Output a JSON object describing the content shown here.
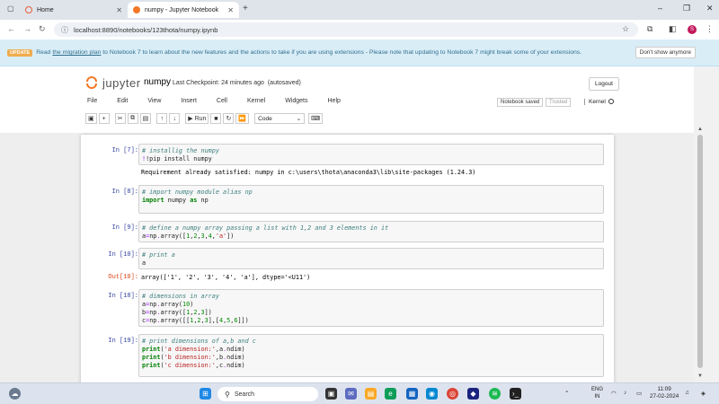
{
  "browser": {
    "tabs": [
      {
        "label": "Home",
        "active": false
      },
      {
        "label": "numpy - Jupyter Notebook",
        "active": true
      }
    ],
    "new_tab": "+",
    "url": "localhost:8890/notebooks/123thota/numpy.ipynb",
    "profile_initial": "S",
    "window_controls": [
      "–",
      "❐",
      "✕"
    ]
  },
  "banner": {
    "badge": "UPDATE",
    "text_pre": "Read",
    "link": "the migration plan",
    "text_post": "to Notebook 7 to learn about the new features and the actions to take if you are using extensions - Please note that updating to Notebook 7 might break some of your extensions.",
    "dismiss": "Don't show anymore"
  },
  "jupyter": {
    "logo_text": "jupyter",
    "notebook_name": "numpy",
    "checkpoint": "Last Checkpoint: 24 minutes ago",
    "autosaved": "(autosaved)",
    "logout": "Logout",
    "menus": [
      "File",
      "Edit",
      "View",
      "Insert",
      "Cell",
      "Kernel",
      "Widgets",
      "Help"
    ],
    "status": "Notebook saved",
    "trusted": "Trusted",
    "kernel_label": "Kernel",
    "run_label": "Run",
    "cell_type": "Code"
  },
  "cells": [
    {
      "prompt": "In [7]:",
      "comment": "# installig the numpy",
      "code": [
        "!pip install numpy"
      ],
      "output": "Requirement already satisfied: numpy in c:\\users\\thota\\anaconda3\\lib\\site-packages (1.24.3)"
    },
    {
      "prompt": "In [8]:",
      "comment": "# import numpy module alias np",
      "code": [
        "import numpy as np"
      ]
    },
    {
      "prompt": "In [9]:",
      "comment": "# define a numpy array passing a list with 1,2 and 3 elements in it",
      "code": [
        "a=np.array([1,2,3,4,'a'])"
      ]
    },
    {
      "prompt": "In [10]:",
      "comment": "# print a",
      "code": [
        "a"
      ],
      "out_prompt": "Out[10]:",
      "output": "array(['1', '2', '3', '4', 'a'], dtype='<U11')"
    },
    {
      "prompt": "In [18]:",
      "comment": "# dimensions in array",
      "code": [
        "a=np.array(10)",
        "b=np.array([1,2,3])",
        "c=np.array([[1,2,3],[4,5,6]])"
      ]
    },
    {
      "prompt": "In [19]:",
      "comment": "# print dimensions of a,b and c",
      "code": [
        "print('a dimension:',a.ndim)",
        "print('b dimension:',b.ndim)",
        "print('c dimension:',c.ndim)"
      ]
    }
  ],
  "taskbar": {
    "search_placeholder": "Search",
    "lang": [
      "ENG",
      "IN"
    ],
    "time": "11:09",
    "date": "27-02-2024"
  }
}
